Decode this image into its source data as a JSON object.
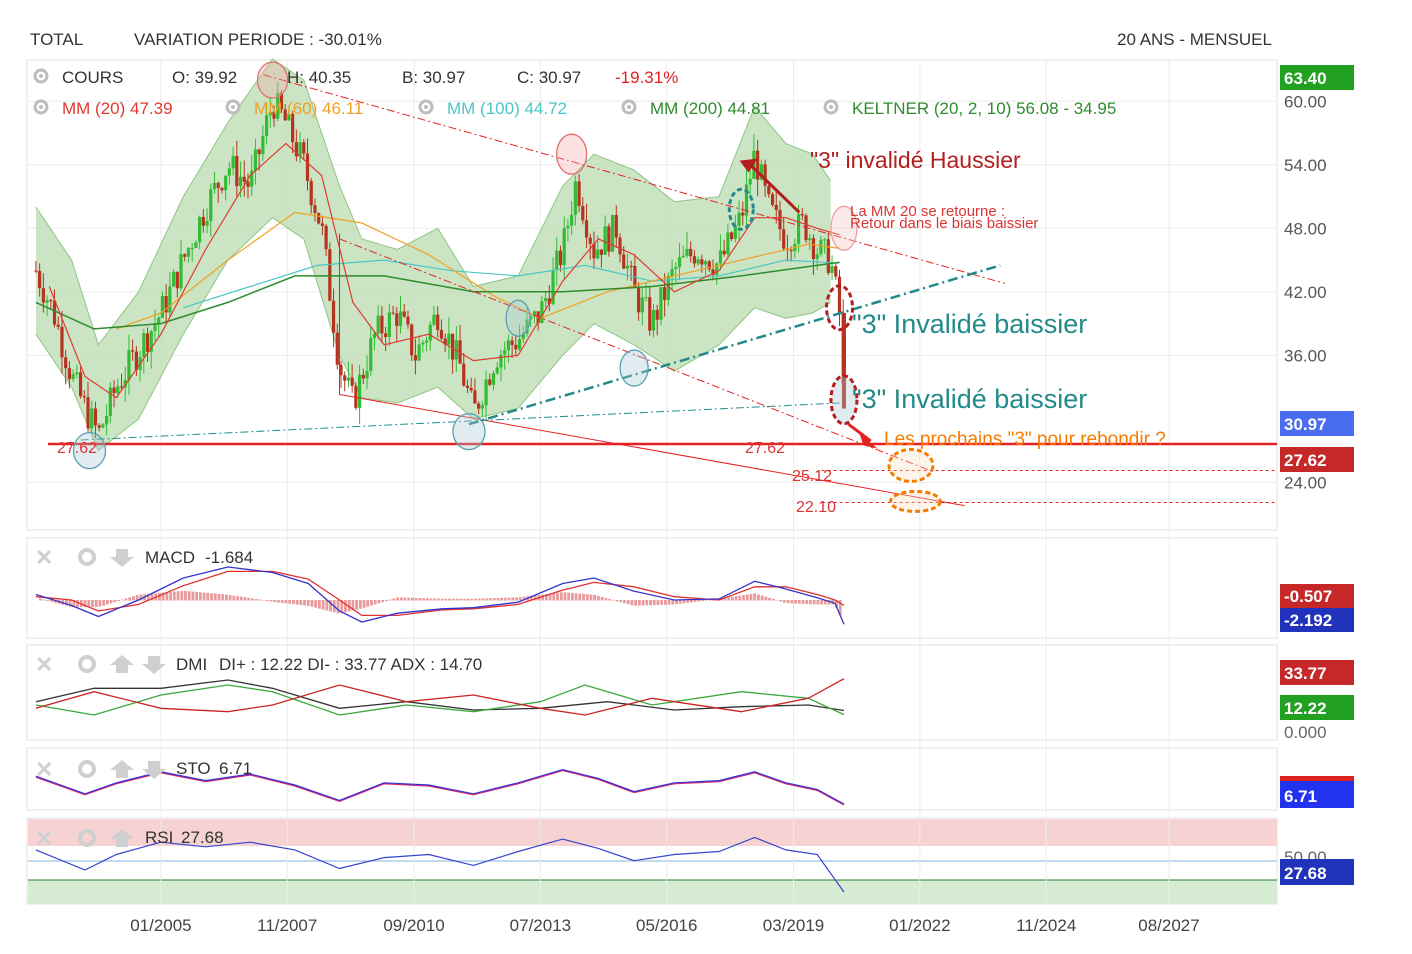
{
  "header": {
    "symbol": "TOTAL",
    "variation": "VARIATION PERIODE : -30.01%",
    "period": "20 ANS - MENSUEL"
  },
  "legend": {
    "cours": "COURS",
    "open": "O: 39.92",
    "high": "H: 40.35",
    "low": "B: 30.97",
    "close": "C: 30.97",
    "change": "-19.31%",
    "mm20": "MM (20)  47.39",
    "mm60": "MM (60)  46.11",
    "mm100": "MM (100)  44.72",
    "mm200": "MM (200)  44.81",
    "keltner": "KELTNER (20, 2, 10)  56.08 - 34.95"
  },
  "colors": {
    "mm20": "#e03a2f",
    "mm60": "#f0a020",
    "mm100": "#4cc6c6",
    "mm200": "#2e8b2e",
    "keltner_fill": "#b9dcb0",
    "keltner_line": "#8fc585",
    "bull": "#33bb33",
    "bear": "#b5331f",
    "support": "#e52222",
    "teal": "#238a8a",
    "orange": "#f57c00",
    "darkred": "#b41e1e",
    "macd": "#3333cc",
    "signal": "#e03030",
    "adx": "#333333",
    "diplus": "#3aa83a",
    "diminus": "#cc2222",
    "sto_k": "#3333dd",
    "sto_d": "#dd2266",
    "rsi": "#3344cc",
    "price_badge": "#4a6cf0",
    "green_badge": "#22a022",
    "red_badge": "#c62828"
  },
  "annotations": {
    "invalide_haussier": "\"3\" invalidé Haussier",
    "mm20_retourne_1": "La MM 20 se retourne :",
    "mm20_retourne_2": "Retour dans le biais baissier",
    "invalide_baissier_1": "\"3\" Invalidé baissier",
    "invalide_baissier_2": "\"3\" Invalidé baissier",
    "prochains": "Les prochains \"3\" pour rebondir ?",
    "lvl_2762_left": "27.62",
    "lvl_2762_mid": "27.62",
    "lvl_2512": "25.12",
    "lvl_2210": "22.10"
  },
  "panels": {
    "macd": {
      "label": "MACD",
      "value": "-1.684",
      "badges": [
        "-0.507",
        "-2.192"
      ]
    },
    "dmi": {
      "label": "DMI",
      "text": "DI+ : 12.22 DI- : 33.77 ADX : 14.70",
      "badges": [
        "33.77",
        "12.22"
      ],
      "axis": "0.000"
    },
    "sto": {
      "label": "STO",
      "value": "6.71",
      "badges": [
        "6.71"
      ]
    },
    "rsi": {
      "label": "RSI",
      "value": "27.68",
      "badges": [
        "27.68"
      ],
      "axis": "50.00"
    }
  },
  "chart_data": {
    "type": "candlestick",
    "title": "TOTAL",
    "y_ticks": [
      24.0,
      36.0,
      42.0,
      48.0,
      54.0,
      60.0
    ],
    "ylim": [
      19.5,
      63.9
    ],
    "price_badges": {
      "high": "63.40",
      "last": "30.97",
      "support": "27.62"
    },
    "x_ticks": [
      "01/2005",
      "11/2007",
      "09/2010",
      "07/2013",
      "05/2016",
      "03/2019",
      "01/2022",
      "11/2024",
      "08/2027"
    ],
    "x_tick_years": [
      2005.0,
      2007.83,
      2010.67,
      2013.5,
      2016.33,
      2019.17,
      2022.0,
      2024.83,
      2027.58
    ],
    "xlim": [
      2002.0,
      2030.0
    ],
    "price_path": [
      [
        2002.2,
        44.0
      ],
      [
        2002.6,
        40.0
      ],
      [
        2003.0,
        34.0
      ],
      [
        2003.3,
        31.0
      ],
      [
        2003.6,
        28.5
      ],
      [
        2004.0,
        33.0
      ],
      [
        2004.5,
        36.5
      ],
      [
        2005.0,
        40.0
      ],
      [
        2005.5,
        45.0
      ],
      [
        2006.0,
        50.0
      ],
      [
        2006.5,
        54.0
      ],
      [
        2007.0,
        52.0
      ],
      [
        2007.5,
        60.0
      ],
      [
        2007.8,
        58.0
      ],
      [
        2008.2,
        54.0
      ],
      [
        2008.6,
        48.0
      ],
      [
        2009.0,
        35.0
      ],
      [
        2009.3,
        31.5
      ],
      [
        2009.8,
        38.0
      ],
      [
        2010.3,
        40.0
      ],
      [
        2010.7,
        36.0
      ],
      [
        2011.2,
        40.0
      ],
      [
        2011.7,
        35.0
      ],
      [
        2012.0,
        30.5
      ],
      [
        2012.5,
        36.0
      ],
      [
        2013.0,
        37.5
      ],
      [
        2013.5,
        40.0
      ],
      [
        2014.0,
        46.0
      ],
      [
        2014.3,
        52.5
      ],
      [
        2014.7,
        46.0
      ],
      [
        2015.2,
        48.0
      ],
      [
        2015.6,
        42.0
      ],
      [
        2016.0,
        39.0
      ],
      [
        2016.5,
        44.0
      ],
      [
        2017.0,
        46.0
      ],
      [
        2017.5,
        44.5
      ],
      [
        2018.0,
        49.0
      ],
      [
        2018.3,
        55.0
      ],
      [
        2018.6,
        50.0
      ],
      [
        2019.0,
        47.0
      ],
      [
        2019.4,
        48.5
      ],
      [
        2019.7,
        46.0
      ],
      [
        2020.0,
        45.0
      ],
      [
        2020.2,
        40.0
      ],
      [
        2020.3,
        30.97
      ]
    ],
    "keltner_upper": [
      [
        2002.2,
        50.0
      ],
      [
        2003.0,
        45.0
      ],
      [
        2003.6,
        37.0
      ],
      [
        2004.5,
        42.0
      ],
      [
        2005.5,
        51.0
      ],
      [
        2006.5,
        58.0
      ],
      [
        2007.5,
        64.0
      ],
      [
        2008.2,
        62.0
      ],
      [
        2009.0,
        52.0
      ],
      [
        2009.5,
        47.0
      ],
      [
        2010.3,
        46.0
      ],
      [
        2011.2,
        48.0
      ],
      [
        2012.0,
        42.5
      ],
      [
        2013.0,
        43.5
      ],
      [
        2014.0,
        52.0
      ],
      [
        2014.7,
        55.0
      ],
      [
        2015.6,
        53.5
      ],
      [
        2016.5,
        50.5
      ],
      [
        2017.5,
        51.0
      ],
      [
        2018.3,
        59.5
      ],
      [
        2019.0,
        56.0
      ],
      [
        2019.6,
        55.0
      ],
      [
        2020.0,
        52.5
      ]
    ],
    "keltner_lower": [
      [
        2002.2,
        38.0
      ],
      [
        2003.0,
        33.0
      ],
      [
        2003.6,
        27.0
      ],
      [
        2004.5,
        30.0
      ],
      [
        2005.5,
        38.0
      ],
      [
        2006.5,
        45.0
      ],
      [
        2007.5,
        49.0
      ],
      [
        2008.2,
        47.0
      ],
      [
        2009.0,
        36.0
      ],
      [
        2009.5,
        32.0
      ],
      [
        2010.3,
        31.5
      ],
      [
        2011.2,
        33.0
      ],
      [
        2012.0,
        30.0
      ],
      [
        2013.0,
        31.0
      ],
      [
        2014.0,
        36.0
      ],
      [
        2014.7,
        39.0
      ],
      [
        2015.6,
        37.0
      ],
      [
        2016.5,
        34.5
      ],
      [
        2017.5,
        37.0
      ],
      [
        2018.3,
        40.5
      ],
      [
        2019.0,
        39.5
      ],
      [
        2019.6,
        40.0
      ],
      [
        2020.0,
        41.0
      ]
    ],
    "mm20": [
      [
        2002.5,
        42.5
      ],
      [
        2003.3,
        34.0
      ],
      [
        2004.0,
        32.0
      ],
      [
        2005.0,
        38.0
      ],
      [
        2006.0,
        46.0
      ],
      [
        2007.0,
        53.0
      ],
      [
        2007.8,
        56.0
      ],
      [
        2008.6,
        53.0
      ],
      [
        2009.3,
        41.0
      ],
      [
        2010.0,
        37.0
      ],
      [
        2011.0,
        38.0
      ],
      [
        2012.0,
        35.5
      ],
      [
        2013.0,
        36.0
      ],
      [
        2014.0,
        43.0
      ],
      [
        2014.8,
        47.0
      ],
      [
        2015.6,
        45.5
      ],
      [
        2016.5,
        42.0
      ],
      [
        2017.5,
        44.0
      ],
      [
        2018.3,
        49.0
      ],
      [
        2019.0,
        49.0
      ],
      [
        2019.7,
        48.0
      ],
      [
        2020.2,
        47.4
      ]
    ],
    "mm60": [
      [
        2004.0,
        38.5
      ],
      [
        2005.0,
        40.0
      ],
      [
        2006.5,
        45.0
      ],
      [
        2008.0,
        49.5
      ],
      [
        2009.5,
        48.5
      ],
      [
        2011.0,
        45.5
      ],
      [
        2012.5,
        41.5
      ],
      [
        2013.5,
        39.5
      ],
      [
        2015.0,
        42.0
      ],
      [
        2016.5,
        43.5
      ],
      [
        2018.0,
        45.0
      ],
      [
        2019.5,
        46.5
      ],
      [
        2020.2,
        46.1
      ]
    ],
    "mm100": [
      [
        2005.5,
        40.5
      ],
      [
        2007.0,
        42.5
      ],
      [
        2008.5,
        44.5
      ],
      [
        2010.0,
        45.0
      ],
      [
        2011.5,
        44.0
      ],
      [
        2013.0,
        43.5
      ],
      [
        2014.5,
        44.5
      ],
      [
        2016.0,
        43.0
      ],
      [
        2017.5,
        43.5
      ],
      [
        2019.0,
        45.0
      ],
      [
        2020.2,
        44.7
      ]
    ],
    "mm200": [
      [
        2002.2,
        41.0
      ],
      [
        2003.5,
        38.5
      ],
      [
        2005.0,
        39.0
      ],
      [
        2006.5,
        41.0
      ],
      [
        2008.0,
        43.5
      ],
      [
        2010.0,
        43.5
      ],
      [
        2012.0,
        42.0
      ],
      [
        2014.0,
        42.0
      ],
      [
        2016.0,
        42.5
      ],
      [
        2018.0,
        43.5
      ],
      [
        2020.2,
        44.8
      ]
    ],
    "support_level": 27.62,
    "targets": [
      25.12,
      22.1
    ],
    "macd_series": [
      [
        2002.2,
        0.5
      ],
      [
        2003.0,
        -0.5
      ],
      [
        2003.6,
        -1.5
      ],
      [
        2004.5,
        0.0
      ],
      [
        2005.5,
        2.0
      ],
      [
        2006.5,
        3.0
      ],
      [
        2007.5,
        2.5
      ],
      [
        2008.3,
        1.5
      ],
      [
        2009.0,
        -1.0
      ],
      [
        2009.5,
        -2.0
      ],
      [
        2010.3,
        -1.2
      ],
      [
        2011.3,
        -0.8
      ],
      [
        2012.0,
        -0.7
      ],
      [
        2013.0,
        -0.2
      ],
      [
        2014.0,
        1.5
      ],
      [
        2014.7,
        2.0
      ],
      [
        2015.6,
        0.8
      ],
      [
        2016.5,
        0.0
      ],
      [
        2017.5,
        0.1
      ],
      [
        2018.3,
        1.7
      ],
      [
        2019.0,
        1.0
      ],
      [
        2019.7,
        0.2
      ],
      [
        2020.1,
        -0.3
      ],
      [
        2020.3,
        -2.2
      ]
    ],
    "macd_signal": [
      [
        2002.2,
        0.3
      ],
      [
        2003.0,
        0.0
      ],
      [
        2003.6,
        -1.0
      ],
      [
        2004.5,
        -0.4
      ],
      [
        2005.5,
        1.3
      ],
      [
        2006.5,
        2.6
      ],
      [
        2007.5,
        2.6
      ],
      [
        2008.3,
        1.9
      ],
      [
        2009.0,
        0.0
      ],
      [
        2009.5,
        -1.4
      ],
      [
        2010.3,
        -1.4
      ],
      [
        2011.3,
        -0.9
      ],
      [
        2012.0,
        -0.8
      ],
      [
        2013.0,
        -0.4
      ],
      [
        2014.0,
        0.9
      ],
      [
        2014.7,
        1.6
      ],
      [
        2015.6,
        1.2
      ],
      [
        2016.5,
        0.3
      ],
      [
        2017.5,
        0.0
      ],
      [
        2018.3,
        1.2
      ],
      [
        2019.0,
        1.2
      ],
      [
        2019.7,
        0.5
      ],
      [
        2020.1,
        0.0
      ],
      [
        2020.3,
        -0.5
      ]
    ],
    "dmi_adx": [
      [
        2002.2,
        20
      ],
      [
        2003.5,
        28
      ],
      [
        2005.0,
        28
      ],
      [
        2006.5,
        33
      ],
      [
        2007.5,
        28
      ],
      [
        2009.0,
        16
      ],
      [
        2010.5,
        20
      ],
      [
        2012.0,
        15
      ],
      [
        2013.5,
        16
      ],
      [
        2015.0,
        20
      ],
      [
        2016.5,
        15
      ],
      [
        2018.0,
        17
      ],
      [
        2019.5,
        18
      ],
      [
        2020.3,
        14.7
      ]
    ],
    "dmi_diplus": [
      [
        2002.2,
        18
      ],
      [
        2003.5,
        12
      ],
      [
        2005.0,
        24
      ],
      [
        2006.5,
        30
      ],
      [
        2007.5,
        26
      ],
      [
        2009.0,
        12
      ],
      [
        2010.5,
        18
      ],
      [
        2012.0,
        14
      ],
      [
        2013.5,
        20
      ],
      [
        2014.5,
        30
      ],
      [
        2016.0,
        18
      ],
      [
        2018.0,
        26
      ],
      [
        2019.5,
        22
      ],
      [
        2020.3,
        12.22
      ]
    ],
    "dmi_diminus": [
      [
        2002.2,
        16
      ],
      [
        2003.5,
        26
      ],
      [
        2005.0,
        16
      ],
      [
        2006.5,
        14
      ],
      [
        2007.5,
        18
      ],
      [
        2009.0,
        30
      ],
      [
        2010.5,
        20
      ],
      [
        2012.0,
        24
      ],
      [
        2013.5,
        16
      ],
      [
        2014.5,
        12
      ],
      [
        2016.0,
        22
      ],
      [
        2018.0,
        14
      ],
      [
        2019.5,
        22
      ],
      [
        2020.3,
        33.77
      ]
    ],
    "sto_k": [
      [
        2002.2,
        70
      ],
      [
        2003.3,
        30
      ],
      [
        2004.0,
        55
      ],
      [
        2005.0,
        80
      ],
      [
        2006.0,
        60
      ],
      [
        2007.0,
        75
      ],
      [
        2008.0,
        50
      ],
      [
        2009.0,
        15
      ],
      [
        2010.0,
        55
      ],
      [
        2011.0,
        50
      ],
      [
        2012.0,
        30
      ],
      [
        2013.0,
        55
      ],
      [
        2014.0,
        85
      ],
      [
        2014.8,
        65
      ],
      [
        2015.6,
        35
      ],
      [
        2016.5,
        55
      ],
      [
        2017.5,
        60
      ],
      [
        2018.3,
        80
      ],
      [
        2019.0,
        55
      ],
      [
        2019.7,
        40
      ],
      [
        2020.3,
        6.71
      ]
    ],
    "rsi_series": [
      [
        2002.2,
        55
      ],
      [
        2003.3,
        42
      ],
      [
        2004.0,
        52
      ],
      [
        2005.0,
        60
      ],
      [
        2006.0,
        57
      ],
      [
        2007.0,
        60
      ],
      [
        2008.0,
        55
      ],
      [
        2009.0,
        43
      ],
      [
        2010.0,
        50
      ],
      [
        2011.0,
        52
      ],
      [
        2012.0,
        45
      ],
      [
        2013.0,
        54
      ],
      [
        2014.0,
        62
      ],
      [
        2014.8,
        56
      ],
      [
        2015.6,
        48
      ],
      [
        2016.5,
        52
      ],
      [
        2017.5,
        54
      ],
      [
        2018.3,
        63
      ],
      [
        2019.0,
        55
      ],
      [
        2019.7,
        52
      ],
      [
        2020.3,
        27.68
      ]
    ]
  }
}
